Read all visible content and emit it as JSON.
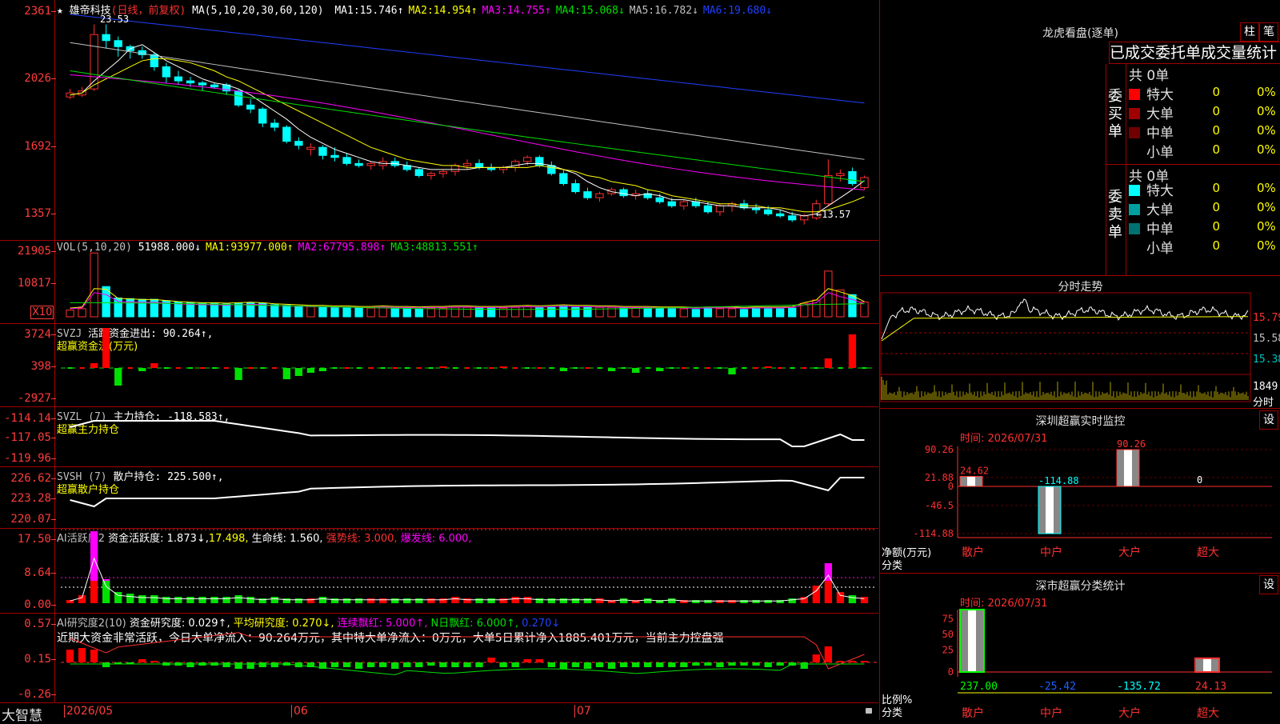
{
  "stock": {
    "star": "★",
    "name": "雄帝科技",
    "period": "(日线，前复权)",
    "ma_label": "MA(5,10,20,30,60,120)",
    "ma": [
      {
        "label": "MA1:",
        "value": "15.746↑",
        "color": "#ffffff"
      },
      {
        "label": "MA2:",
        "value": "14.954↑",
        "color": "#ffff00"
      },
      {
        "label": "MA3:",
        "value": "14.755↑",
        "color": "#ff00ff"
      },
      {
        "label": "MA4:",
        "value": "15.068↓",
        "color": "#00e000"
      },
      {
        "label": "MA5:",
        "value": "16.782↓",
        "color": "#c0c0c0"
      },
      {
        "label": "MA6:",
        "value": "19.680↓",
        "color": "#2040ff"
      }
    ],
    "high_label": "23.53",
    "low_label": "←13.57",
    "y_labels": [
      "2361",
      "2026",
      "1692",
      "1357"
    ]
  },
  "vol": {
    "label": "VOL(5,10,20)",
    "value": "51988.000↓",
    "ma": [
      {
        "label": "MA1:",
        "value": "93977.000↑",
        "color": "#ffff00"
      },
      {
        "label": "MA2:",
        "value": "67795.898↑",
        "color": "#ff00ff"
      },
      {
        "label": "MA3:",
        "value": "48813.551↑",
        "color": "#00e000"
      }
    ],
    "y_labels": [
      "21905",
      "10817"
    ],
    "unit": "X10"
  },
  "svzj": {
    "label": "SVZJ",
    "text": "活跃资金进出: 90.264↑,",
    "sub": "超赢资金流(万元)",
    "y_labels": [
      "3724",
      "398",
      "-2927"
    ]
  },
  "svzl": {
    "label": "SVZL (7)",
    "text": "主力持仓: -118.583↑,",
    "sub": "超赢主力持仓",
    "y_labels": [
      "-114.14",
      "-117.05",
      "-119.96"
    ]
  },
  "svsh": {
    "label": "SVSH (7)",
    "text": "散户持仓: 225.500↑,",
    "sub": "超赢散户持仓",
    "y_labels": [
      "226.62",
      "223.28",
      "220.07"
    ]
  },
  "ai1": {
    "label": "AI活跃度2",
    "t1": "资金活跃度: 1.873↓,",
    "t2": "17.498,",
    "t3": "生命线: 1.560,",
    "t4": "强势线: 3.000,",
    "t5": "爆发线: 6.000,",
    "y_labels": [
      "17.50",
      "8.64",
      "0.00"
    ]
  },
  "ai2": {
    "label": "AI研究度2(10)",
    "t1": "资金研究度: 0.029↑,",
    "t2": "平均研究度: 0.270↓,",
    "t3": "连续飘红: 5.000↑,",
    "t4": "N日飘红: 6.000↑,",
    "t5": "0.270↓",
    "comment": "近期大资金非常活跃，今日大单净流入：90.264万元，其中特大单净流入：0万元，大单5日累计净入1885.401万元，当前主力控盘强",
    "y_labels": [
      "0.57",
      "0.15",
      "-0.26"
    ]
  },
  "xaxis": {
    "brand": "大智慧",
    "labels": [
      "2026/05",
      "06",
      "07"
    ]
  },
  "right": {
    "longhu": {
      "title": "龙虎看盘(逐单)",
      "btn1": "柱",
      "btn2": "笔",
      "header": "已成交委托单成交量统计",
      "buy": {
        "side": "委买单",
        "total": "共 0单",
        "rows": [
          {
            "label": "特大",
            "value": "0",
            "pct": "0%",
            "color": "#ff0000"
          },
          {
            "label": "大单",
            "value": "0",
            "pct": "0%",
            "color": "#a00000"
          },
          {
            "label": "中单",
            "value": "0",
            "pct": "0%",
            "color": "#700000"
          },
          {
            "label": "小单",
            "value": "0",
            "pct": "0%",
            "color": "#000000"
          }
        ]
      },
      "sell": {
        "side": "委卖单",
        "total": "共 0单",
        "rows": [
          {
            "label": "特大",
            "value": "0",
            "pct": "0%",
            "color": "#00ffff"
          },
          {
            "label": "大单",
            "value": "0",
            "pct": "0%",
            "color": "#00a0a0"
          },
          {
            "label": "中单",
            "value": "0",
            "pct": "0%",
            "color": "#007070"
          },
          {
            "label": "小单",
            "value": "0",
            "pct": "0%",
            "color": "#000000"
          }
        ]
      }
    },
    "intraday": {
      "title": "分时走势",
      "prices": [
        "15.79",
        "15.58",
        "15.38"
      ],
      "vol_label": "1849",
      "vol_unit": "分时"
    },
    "monitor": {
      "title": "深圳超赢实时监控",
      "btn": "设",
      "time": "时间: 2026/07/31",
      "y_labels": [
        "90.26",
        "21.88",
        "0",
        "-46.5",
        "-114.88"
      ],
      "unit": "净额(万元)",
      "cat_label": "分类",
      "categories": [
        "散户",
        "中户",
        "大户",
        "超大"
      ],
      "values": [
        24.62,
        -114.88,
        90.26,
        0
      ],
      "value_labels": [
        "24.62",
        "-114.88",
        "90.26",
        "0"
      ]
    },
    "classify": {
      "title": "深市超赢分类统计",
      "btn": "设",
      "time": "时间: 2026/07/31",
      "y_labels": [
        "75",
        "50",
        "25",
        "0"
      ],
      "unit": "比例%",
      "cat_label": "分类",
      "categories": [
        "散户",
        "中户",
        "大户",
        "超大"
      ],
      "value_labels": [
        "237.00",
        "-25.42",
        "-135.72",
        "24.13"
      ]
    }
  },
  "chart_data": {
    "type": "candlestick",
    "title": "雄帝科技 (日线，前复权)",
    "ylim": [
      13.0,
      24.0
    ],
    "candles": [
      [
        19.9,
        20.3,
        19.8,
        20.1
      ],
      [
        20.0,
        20.4,
        19.9,
        20.2
      ],
      [
        20.3,
        23.5,
        20.2,
        23.0
      ],
      [
        23.0,
        23.5,
        22.3,
        22.7
      ],
      [
        22.7,
        22.9,
        21.9,
        22.4
      ],
      [
        22.4,
        22.5,
        21.8,
        22.2
      ],
      [
        22.2,
        22.4,
        21.8,
        22.0
      ],
      [
        22.0,
        22.1,
        21.2,
        21.4
      ],
      [
        21.4,
        21.6,
        20.6,
        20.9
      ],
      [
        20.9,
        21.2,
        20.5,
        20.7
      ],
      [
        20.7,
        20.9,
        20.4,
        20.6
      ],
      [
        20.6,
        20.7,
        20.2,
        20.5
      ],
      [
        20.5,
        20.6,
        20.3,
        20.4
      ],
      [
        20.5,
        20.6,
        20.0,
        20.2
      ],
      [
        20.2,
        20.3,
        19.4,
        19.5
      ],
      [
        19.5,
        19.8,
        19.1,
        19.3
      ],
      [
        19.3,
        19.4,
        18.4,
        18.6
      ],
      [
        18.6,
        18.8,
        18.2,
        18.4
      ],
      [
        18.4,
        18.5,
        17.6,
        17.7
      ],
      [
        17.7,
        17.9,
        17.3,
        17.5
      ],
      [
        17.3,
        17.6,
        17.0,
        17.4
      ],
      [
        17.4,
        17.5,
        16.8,
        17.0
      ],
      [
        17.0,
        17.4,
        16.7,
        16.9
      ],
      [
        16.9,
        17.1,
        16.5,
        16.6
      ],
      [
        16.6,
        16.8,
        16.4,
        16.5
      ],
      [
        16.5,
        16.7,
        16.3,
        16.6
      ],
      [
        16.5,
        16.9,
        16.3,
        16.7
      ],
      [
        16.7,
        16.9,
        16.4,
        16.5
      ],
      [
        16.5,
        16.7,
        16.2,
        16.3
      ],
      [
        16.3,
        16.4,
        15.9,
        16.0
      ],
      [
        16.0,
        16.2,
        15.8,
        16.1
      ],
      [
        16.1,
        16.3,
        15.9,
        16.2
      ],
      [
        16.2,
        16.6,
        16.0,
        16.5
      ],
      [
        16.5,
        16.8,
        16.3,
        16.6
      ],
      [
        16.6,
        16.8,
        16.3,
        16.4
      ],
      [
        16.4,
        16.6,
        16.2,
        16.3
      ],
      [
        16.3,
        16.5,
        16.1,
        16.4
      ],
      [
        16.4,
        16.8,
        16.2,
        16.7
      ],
      [
        16.7,
        17.0,
        16.5,
        16.9
      ],
      [
        16.9,
        17.0,
        16.4,
        16.5
      ],
      [
        16.5,
        16.7,
        16.0,
        16.1
      ],
      [
        16.1,
        16.3,
        15.5,
        15.6
      ],
      [
        15.6,
        15.8,
        15.1,
        15.2
      ],
      [
        15.2,
        15.4,
        14.8,
        14.9
      ],
      [
        14.9,
        15.2,
        14.7,
        15.1
      ],
      [
        15.1,
        15.4,
        15.0,
        15.3
      ],
      [
        15.3,
        15.4,
        14.9,
        15.0
      ],
      [
        15.0,
        15.3,
        14.8,
        15.1
      ],
      [
        15.1,
        15.3,
        14.8,
        14.9
      ],
      [
        14.9,
        15.1,
        14.6,
        14.7
      ],
      [
        14.7,
        14.9,
        14.4,
        14.5
      ],
      [
        14.5,
        14.8,
        14.3,
        14.7
      ],
      [
        14.7,
        14.9,
        14.4,
        14.5
      ],
      [
        14.5,
        14.7,
        14.1,
        14.2
      ],
      [
        14.2,
        14.6,
        14.0,
        14.5
      ],
      [
        14.5,
        14.7,
        14.2,
        14.6
      ],
      [
        14.6,
        14.8,
        14.3,
        14.4
      ],
      [
        14.4,
        14.6,
        14.1,
        14.3
      ],
      [
        14.3,
        14.5,
        14.0,
        14.1
      ],
      [
        14.1,
        14.3,
        13.9,
        14.0
      ],
      [
        14.0,
        14.2,
        13.7,
        13.8
      ],
      [
        13.8,
        14.1,
        13.57,
        14.0
      ],
      [
        13.9,
        14.8,
        13.8,
        14.6
      ],
      [
        14.6,
        16.8,
        14.5,
        16.0
      ],
      [
        16.0,
        16.3,
        15.7,
        16.1
      ],
      [
        16.2,
        16.4,
        15.5,
        15.6
      ],
      [
        15.4,
        16.0,
        15.3,
        15.9
      ]
    ],
    "ma": {
      "MA5": [
        20.0,
        20.1,
        20.7,
        21.2,
        21.7,
        22.3,
        22.5,
        22.1,
        21.7,
        21.4,
        21.1,
        20.8,
        20.6,
        20.5,
        20.3,
        20.0,
        19.6,
        19.2,
        18.8,
        18.3,
        17.9,
        17.6,
        17.3,
        17.1,
        16.9,
        16.7,
        16.6,
        16.6,
        16.5,
        16.4,
        16.3,
        16.3,
        16.3,
        16.3,
        16.4,
        16.4,
        16.4,
        16.5,
        16.6,
        16.6,
        16.5,
        16.3,
        16.1,
        15.7,
        15.4,
        15.2,
        15.1,
        15.0,
        15.1,
        15.0,
        14.8,
        14.8,
        14.7,
        14.6,
        14.5,
        14.5,
        14.4,
        14.4,
        14.4,
        14.3,
        14.1,
        14.0,
        14.1,
        14.5,
        14.9,
        15.3,
        15.75
      ],
      "MA10": [
        20.0,
        20.1,
        20.5,
        20.8,
        21.1,
        21.4,
        21.7,
        21.8,
        21.8,
        21.7,
        21.6,
        21.4,
        21.2,
        20.9,
        20.7,
        20.4,
        20.1,
        19.8,
        19.5,
        19.2,
        18.9,
        18.6,
        18.3,
        18.0,
        17.7,
        17.4,
        17.2,
        17.0,
        16.8,
        16.7,
        16.6,
        16.5,
        16.5,
        16.4,
        16.4,
        16.4,
        16.4,
        16.4,
        16.4,
        16.5,
        16.4,
        16.3,
        16.2,
        16.0,
        15.9,
        15.7,
        15.6,
        15.5,
        15.3,
        15.2,
        15.0,
        14.9,
        14.8,
        14.7,
        14.6,
        14.6,
        14.5,
        14.5,
        14.4,
        14.4,
        14.3,
        14.2,
        14.2,
        14.3,
        14.5,
        14.7,
        14.95
      ]
    }
  }
}
